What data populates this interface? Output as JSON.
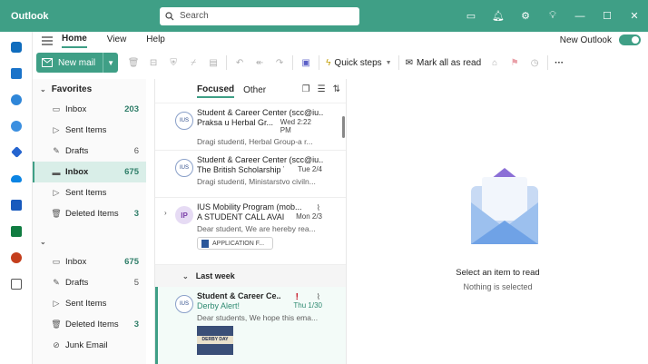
{
  "app": {
    "title": "Outlook"
  },
  "search": {
    "placeholder": "Search"
  },
  "ribbon": {
    "tabs": [
      "Home",
      "View",
      "Help"
    ],
    "active_tab": "Home",
    "new_outlook_label": "New Outlook",
    "new_outlook_toggle": "on"
  },
  "toolbar": {
    "new_mail_label": "New mail",
    "quick_steps_label": "Quick steps",
    "mark_all_read_label": "Mark all as read",
    "more_label": "···"
  },
  "folders": {
    "favorites_label": "Favorites",
    "favorites": [
      {
        "name": "Inbox",
        "count": "203"
      },
      {
        "name": "Sent Items",
        "count": ""
      },
      {
        "name": "Drafts",
        "count": "6"
      },
      {
        "name": "Inbox",
        "count": "675"
      },
      {
        "name": "Sent Items",
        "count": ""
      },
      {
        "name": "Deleted Items",
        "count": "3"
      }
    ],
    "account": [
      {
        "name": "Inbox",
        "count": "675"
      },
      {
        "name": "Drafts",
        "count": "5"
      },
      {
        "name": "Sent Items",
        "count": ""
      },
      {
        "name": "Deleted Items",
        "count": "3"
      },
      {
        "name": "Junk Email",
        "count": ""
      }
    ]
  },
  "message_list": {
    "tabs": [
      "Focused",
      "Other"
    ],
    "active_tab": "Focused",
    "messages": [
      {
        "from": "Student & Career Center (scc@iu...",
        "subject": "Praksa u Herbal Gr...",
        "date": "Wed 2:22 PM",
        "preview": "Dragi studenti, Herbal Group-a r..."
      },
      {
        "from": "Student & Career Center (scc@iu...",
        "subject": "The British Scholarship T...",
        "date": "Tue 2/4",
        "preview": "Dragi studenti, Ministarstvo civiln..."
      },
      {
        "from": "IUS Mobility Program (mob...",
        "subject": "A STUDENT CALL AVAI...",
        "date": "Mon 2/3",
        "preview": "Dear student, We are hereby rea...",
        "initials": "IP",
        "attachment": "APPLICATION F..."
      }
    ],
    "section_last_week": "Last week",
    "unread_message": {
      "from": "Student & Career Ce...",
      "subject": "Derby Alert!",
      "date": "Thu 1/30",
      "preview": "Dear students, We hope this ema...",
      "image_text": "DERBY DAY"
    }
  },
  "reading_pane": {
    "title": "Select an item to read",
    "subtitle": "Nothing is selected"
  },
  "colors": {
    "brand": "#3f9f86",
    "unread_accent": "#2e8a71",
    "flag": "#c50f1f"
  }
}
